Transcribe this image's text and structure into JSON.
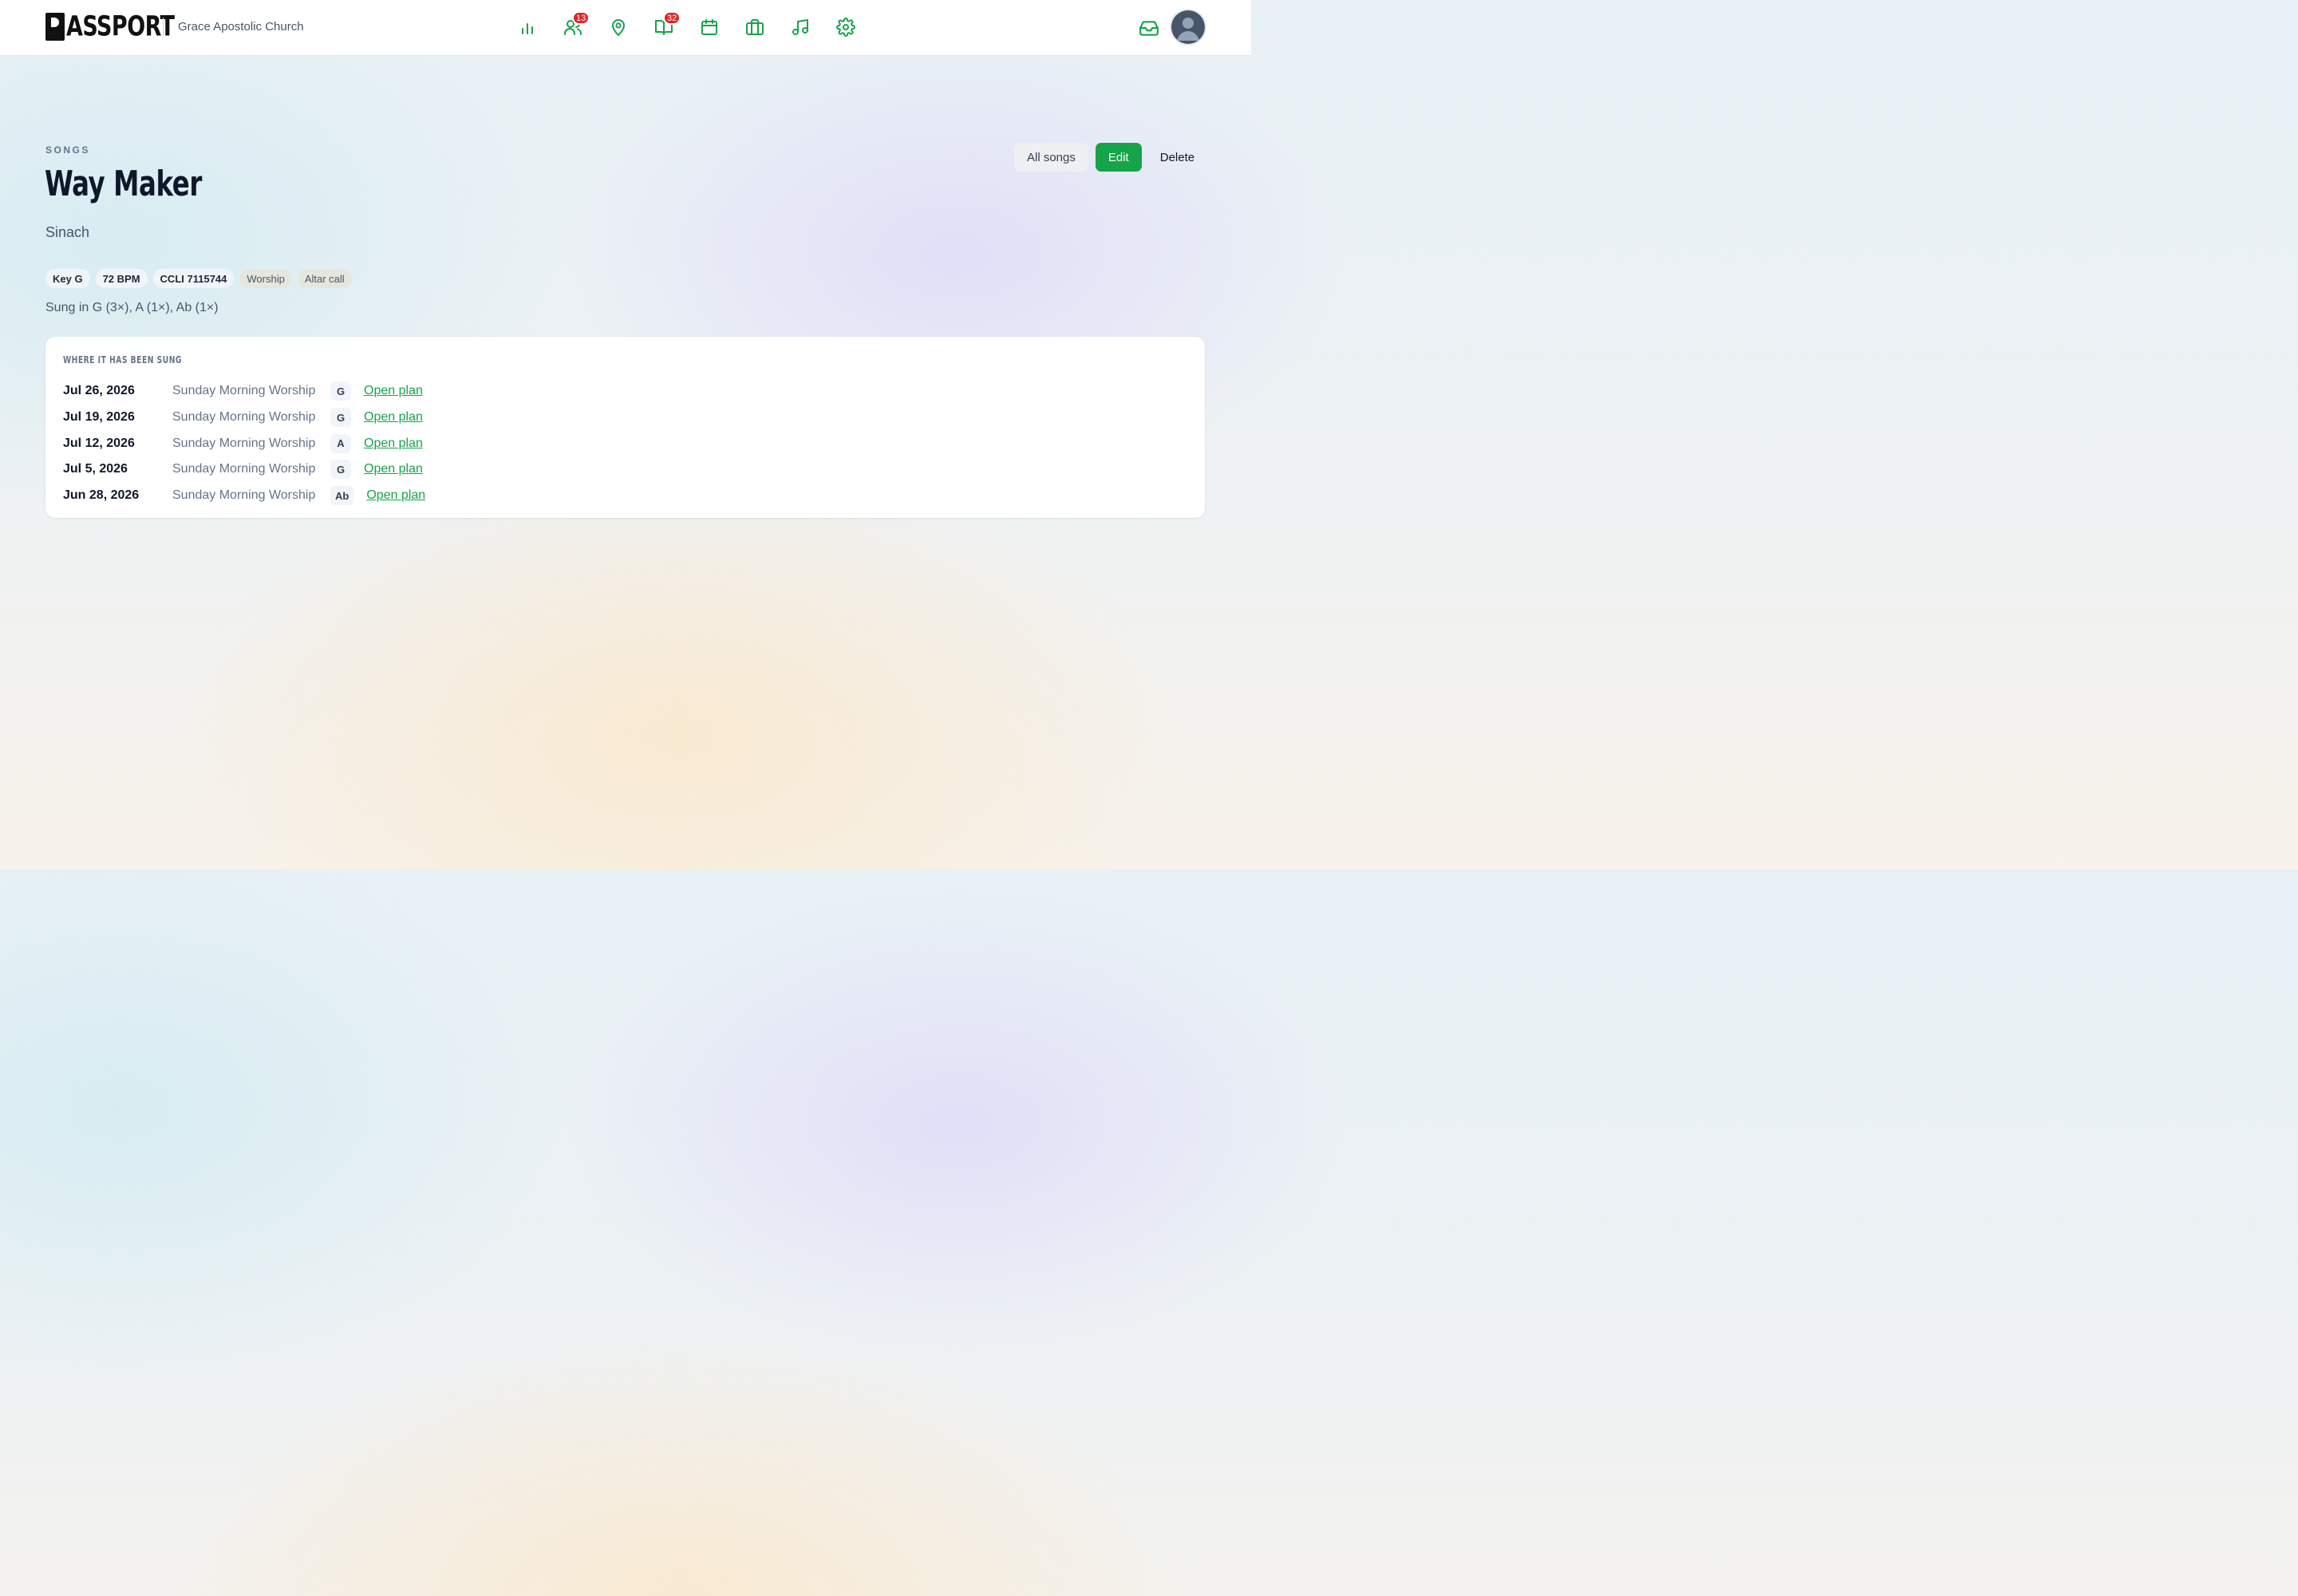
{
  "header": {
    "brand": "ASSPORT",
    "org_name": "Grace Apostolic Church",
    "nav": [
      {
        "icon": "bar-chart-icon",
        "badge": ""
      },
      {
        "icon": "people-icon",
        "badge": "13"
      },
      {
        "icon": "map-pin-icon",
        "badge": ""
      },
      {
        "icon": "open-book-icon",
        "badge": "32"
      },
      {
        "icon": "calendar-icon",
        "badge": ""
      },
      {
        "icon": "briefcase-icon",
        "badge": ""
      },
      {
        "icon": "music-note-icon",
        "badge": ""
      },
      {
        "icon": "gear-icon",
        "badge": ""
      }
    ],
    "inbox_icon": "inbox-icon",
    "avatar_icon": "user-avatar-icon"
  },
  "page": {
    "eyebrow": "SONGS",
    "title": "Way Maker",
    "artist": "Sinach",
    "actions": {
      "all_songs": "All songs",
      "edit": "Edit",
      "delete": "Delete"
    },
    "chips": [
      {
        "label": "Key G",
        "kind": "meta"
      },
      {
        "label": "72 BPM",
        "kind": "meta"
      },
      {
        "label": "CCLI 7115744",
        "kind": "meta"
      },
      {
        "label": "Worship",
        "kind": "tag"
      },
      {
        "label": "Altar call",
        "kind": "tag"
      }
    ],
    "sung_in": "Sung in G (3×), A (1×), Ab (1×)"
  },
  "history": {
    "title": "WHERE IT HAS BEEN SUNG",
    "rows": [
      {
        "date": "Jul 26, 2026",
        "service": "Sunday Morning Worship",
        "key": "G",
        "link": "Open plan"
      },
      {
        "date": "Jul 19, 2026",
        "service": "Sunday Morning Worship",
        "key": "G",
        "link": "Open plan"
      },
      {
        "date": "Jul 12, 2026",
        "service": "Sunday Morning Worship",
        "key": "A",
        "link": "Open plan"
      },
      {
        "date": "Jul 5, 2026",
        "service": "Sunday Morning Worship",
        "key": "G",
        "link": "Open plan"
      },
      {
        "date": "Jun 28, 2026",
        "service": "Sunday Morning Worship",
        "key": "Ab",
        "link": "Open plan"
      }
    ]
  },
  "colors": {
    "accent": "#16a34a",
    "badge": "#dc2626",
    "avatar_bg": "#475569"
  }
}
